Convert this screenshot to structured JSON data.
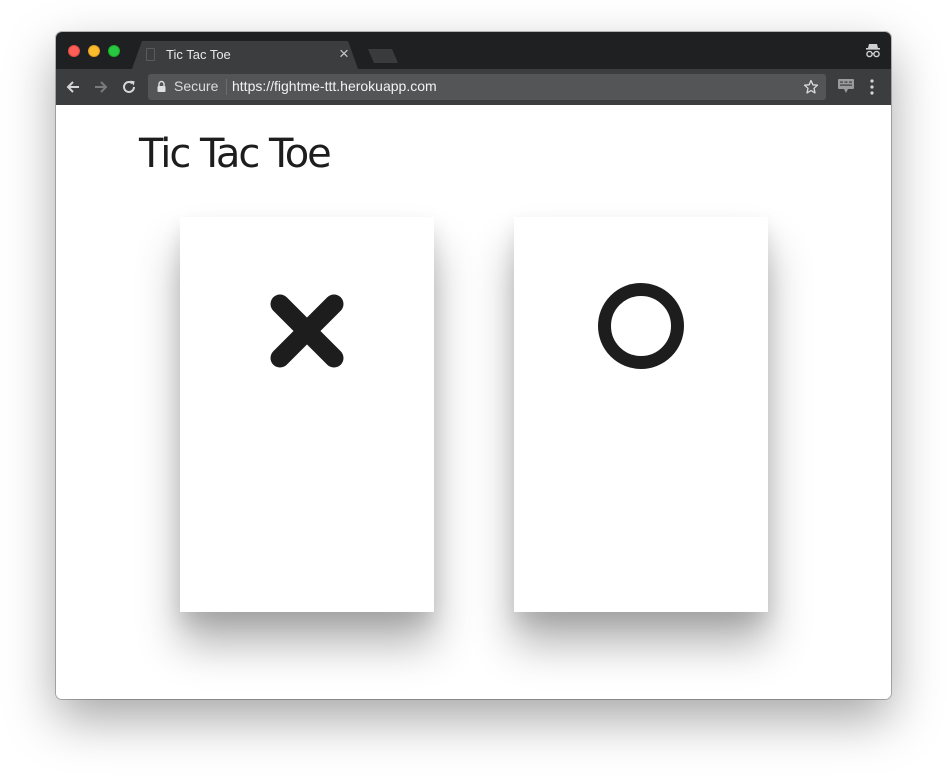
{
  "browser": {
    "tab_title": "Tic Tac Toe",
    "tab_close_glyph": "×",
    "security_label": "Secure",
    "url": "https://fightme-ttt.herokuapp.com",
    "icons": [
      "close-window-icon",
      "minimize-window-icon",
      "maximize-window-icon",
      "page-favicon-icon",
      "back-arrow-icon",
      "forward-arrow-icon",
      "reload-icon",
      "lock-icon",
      "bookmark-star-icon",
      "extension-icon",
      "menu-dots-icon",
      "incognito-icon"
    ]
  },
  "page": {
    "title": "Tic Tac Toe",
    "choices": [
      {
        "symbol": "X",
        "icon": "x-mark-icon"
      },
      {
        "symbol": "O",
        "icon": "o-mark-icon"
      }
    ]
  },
  "colors": {
    "title_bar": "#1f2022",
    "toolbar": "#3c3d3f",
    "mark": "#1d1d1d",
    "close": "#fc5f57",
    "minimize": "#fdbc2e",
    "maximize": "#28c940"
  }
}
